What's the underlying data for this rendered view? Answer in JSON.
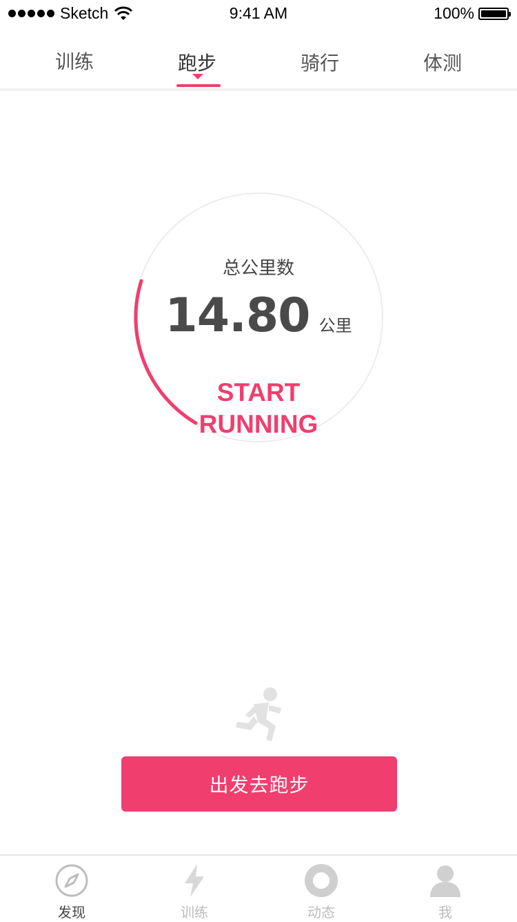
{
  "status_bar": {
    "carrier": "Sketch",
    "time": "9:41 AM",
    "battery": "100%"
  },
  "top_tabs": [
    {
      "label": "训练"
    },
    {
      "label": "跑步",
      "active": true
    },
    {
      "label": "骑行"
    },
    {
      "label": "体测"
    }
  ],
  "ring": {
    "title": "总公里数",
    "value": "14.80",
    "unit": "公里",
    "start_line1": "START",
    "start_line2": "RUNNING"
  },
  "go_button": "出发去跑步",
  "bottom_nav": [
    {
      "label": "发现",
      "icon": "compass-icon",
      "active": true
    },
    {
      "label": "训练",
      "icon": "lightning-icon"
    },
    {
      "label": "动态",
      "icon": "ring-icon"
    },
    {
      "label": "我",
      "icon": "user-icon"
    }
  ],
  "colors": {
    "accent": "#f03e6e",
    "text": "#333333",
    "inactive": "#bbbbbb"
  }
}
